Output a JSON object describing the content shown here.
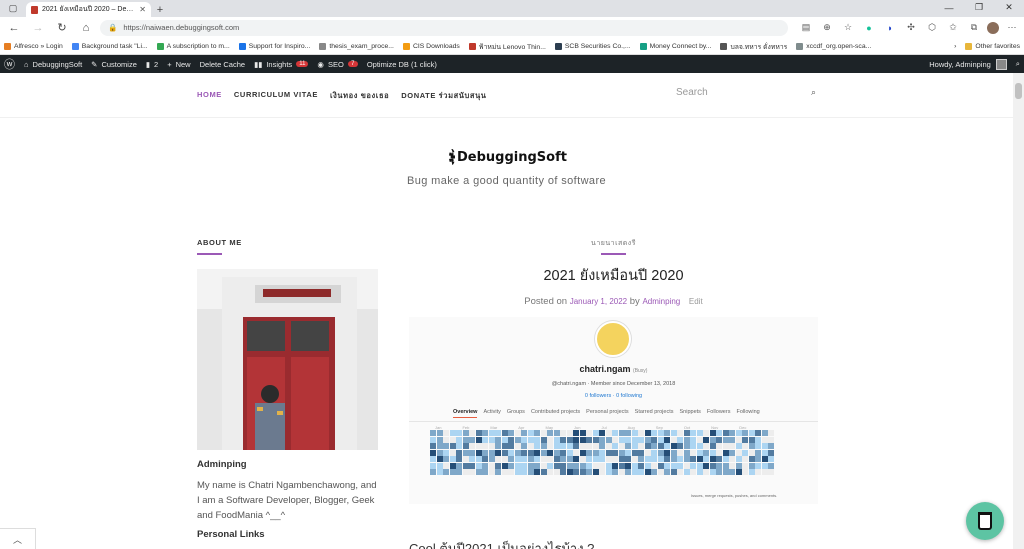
{
  "browser": {
    "tab_title": "2021 ยังเหมือนปี 2020 – Debugging...",
    "url": "https://naiwaen.debuggingsoft.com",
    "bookmarks": [
      "Alfresco » Login",
      "Background task \"Li...",
      "A subscription to m...",
      "Support for Inspiro...",
      "thesis_exam_proce...",
      "CIS Downloads",
      "ฟ้าหม่น Lenovo Thin...",
      "SCB Securities Co.,...",
      "Money Connect by...",
      "บลจ.ทหาร ดั่งทหาร",
      "xccdf_org.open-sca..."
    ],
    "other_favorites": "Other favorites",
    "bookmark_colors": [
      "#e67e22",
      "#4285f4",
      "#34a853",
      "#1a73e8",
      "#888888",
      "#f39c12",
      "#c0392b",
      "#2c3e50",
      "#16a085",
      "#555555",
      "#7f8c8d"
    ]
  },
  "wp_admin": {
    "site": "DebuggingSoft",
    "customize": "Customize",
    "comments_count": "2",
    "new": "New",
    "delete_cache": "Delete Cache",
    "insights": "Insights",
    "insights_badge": "11",
    "seo": "SEO",
    "seo_badge": "7",
    "optimize": "Optimize DB (1 click)",
    "howdy": "Howdy, Adminping"
  },
  "site": {
    "menu": [
      "HOME",
      "CURRICULUM VITAE",
      "เงินทอง ของเธอ",
      "DONATE ร่วมสนับสนุน"
    ],
    "search_placeholder": "Search",
    "logo_text": "DebuggingSoft",
    "tagline": "Bug make a good quantity of software"
  },
  "sidebar": {
    "widget_title": "ABOUT ME",
    "author_name": "Adminping",
    "bio": "My name is Chatri Ngambenchawong, and I am a Software Developer, Blogger, Geek and FoodMania ^__^",
    "personal_links": "Personal Links"
  },
  "post": {
    "category": "นายนาเสดงรี",
    "title": "2021 ยังเหมือนปี 2020",
    "posted_on": "Posted on",
    "date": "January 1, 2022",
    "by": "by",
    "author": "Adminping",
    "edit": "Edit",
    "next_heading": "Cool ต้นปี2021 เป็นอย่างไรบ้าง ?"
  },
  "gitlab": {
    "name": "chatri.ngam",
    "status": "(Busy)",
    "meta": "@chatri.ngam  ·  Member since December 13, 2018",
    "follow": "0 followers  ·  0 following",
    "tabs": [
      "Overview",
      "Activity",
      "Groups",
      "Contributed projects",
      "Personal projects",
      "Starred projects",
      "Snippets",
      "Followers",
      "Following"
    ],
    "months": [
      "Jan",
      "Feb",
      "Mar",
      "Apr",
      "May",
      "Jun",
      "Jul",
      "Aug",
      "Sep",
      "Oct",
      "Nov",
      "Dec"
    ],
    "legend": "Issues, merge requests, pushes, and comments."
  }
}
